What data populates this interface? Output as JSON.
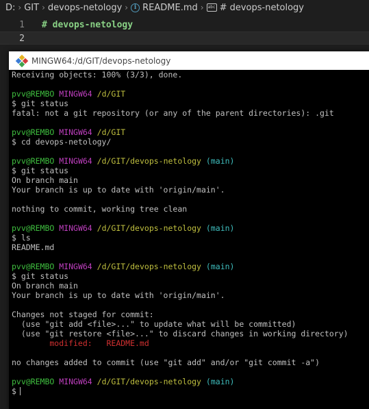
{
  "breadcrumb": {
    "items": [
      "D:",
      "GIT",
      "devops-netology",
      "README.md",
      "# devops-netology"
    ],
    "separator": "›"
  },
  "editor": {
    "lines": [
      {
        "number": "1",
        "text": "# devops-netology"
      },
      {
        "number": "2",
        "text": ""
      }
    ]
  },
  "terminal": {
    "title": "MINGW64:/d/GIT/devops-netology",
    "lines": [
      [
        {
          "t": "Receiving objects: 100% (3/3), done."
        }
      ],
      [],
      [
        {
          "t": "pvv@REMBO",
          "c": "c-green"
        },
        {
          "t": " "
        },
        {
          "t": "MINGW64",
          "c": "c-magenta"
        },
        {
          "t": " "
        },
        {
          "t": "/d/GIT",
          "c": "c-yellow"
        }
      ],
      [
        {
          "t": "$ git status"
        }
      ],
      [
        {
          "t": "fatal: not a git repository (or any of the parent directories): .git"
        }
      ],
      [],
      [
        {
          "t": "pvv@REMBO",
          "c": "c-green"
        },
        {
          "t": " "
        },
        {
          "t": "MINGW64",
          "c": "c-magenta"
        },
        {
          "t": " "
        },
        {
          "t": "/d/GIT",
          "c": "c-yellow"
        }
      ],
      [
        {
          "t": "$ cd devops-netology/"
        }
      ],
      [],
      [
        {
          "t": "pvv@REMBO",
          "c": "c-green"
        },
        {
          "t": " "
        },
        {
          "t": "MINGW64",
          "c": "c-magenta"
        },
        {
          "t": " "
        },
        {
          "t": "/d/GIT/devops-netology",
          "c": "c-yellow"
        },
        {
          "t": " "
        },
        {
          "t": "(main)",
          "c": "c-cyan"
        }
      ],
      [
        {
          "t": "$ git status"
        }
      ],
      [
        {
          "t": "On branch main"
        }
      ],
      [
        {
          "t": "Your branch is up to date with 'origin/main'."
        }
      ],
      [],
      [
        {
          "t": "nothing to commit, working tree clean"
        }
      ],
      [],
      [
        {
          "t": "pvv@REMBO",
          "c": "c-green"
        },
        {
          "t": " "
        },
        {
          "t": "MINGW64",
          "c": "c-magenta"
        },
        {
          "t": " "
        },
        {
          "t": "/d/GIT/devops-netology",
          "c": "c-yellow"
        },
        {
          "t": " "
        },
        {
          "t": "(main)",
          "c": "c-cyan"
        }
      ],
      [
        {
          "t": "$ ls"
        }
      ],
      [
        {
          "t": "README.md"
        }
      ],
      [],
      [
        {
          "t": "pvv@REMBO",
          "c": "c-green"
        },
        {
          "t": " "
        },
        {
          "t": "MINGW64",
          "c": "c-magenta"
        },
        {
          "t": " "
        },
        {
          "t": "/d/GIT/devops-netology",
          "c": "c-yellow"
        },
        {
          "t": " "
        },
        {
          "t": "(main)",
          "c": "c-cyan"
        }
      ],
      [
        {
          "t": "$ git status"
        }
      ],
      [
        {
          "t": "On branch main"
        }
      ],
      [
        {
          "t": "Your branch is up to date with 'origin/main'."
        }
      ],
      [],
      [
        {
          "t": "Changes not staged for commit:"
        }
      ],
      [
        {
          "t": "  (use \"git add <file>...\" to update what will be committed)"
        }
      ],
      [
        {
          "t": "  (use \"git restore <file>...\" to discard changes in working directory)"
        }
      ],
      [
        {
          "t": "        modified:   README.md",
          "c": "c-red"
        }
      ],
      [],
      [
        {
          "t": "no changes added to commit (use \"git add\" and/or \"git commit -a\")"
        }
      ],
      [],
      [
        {
          "t": "pvv@REMBO",
          "c": "c-green"
        },
        {
          "t": " "
        },
        {
          "t": "MINGW64",
          "c": "c-magenta"
        },
        {
          "t": " "
        },
        {
          "t": "/d/GIT/devops-netology",
          "c": "c-yellow"
        },
        {
          "t": " "
        },
        {
          "t": "(main)",
          "c": "c-cyan"
        }
      ],
      [
        {
          "t": "$"
        }
      ]
    ]
  }
}
